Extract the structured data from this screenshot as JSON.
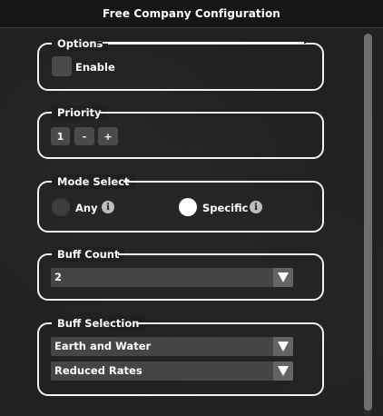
{
  "window": {
    "title": "Free Company Configuration"
  },
  "options": {
    "title": "Options",
    "enable_label": "Enable",
    "enable_checked": false
  },
  "priority": {
    "title": "Priority",
    "value": "1",
    "decrement_label": "-",
    "increment_label": "+"
  },
  "mode_select": {
    "title": "Mode Select",
    "options": [
      {
        "label": "Any",
        "selected": false
      },
      {
        "label": "Specific",
        "selected": true
      }
    ],
    "info_glyph": "i"
  },
  "buff_count": {
    "title": "Buff Count",
    "selected": "2"
  },
  "buff_selection": {
    "title": "Buff Selection",
    "slots": [
      {
        "selected": "Earth and Water"
      },
      {
        "selected": "Reduced Rates"
      }
    ]
  },
  "icons": {
    "dropdown_arrow": "dropdown-arrow-icon",
    "info": "info-icon"
  }
}
